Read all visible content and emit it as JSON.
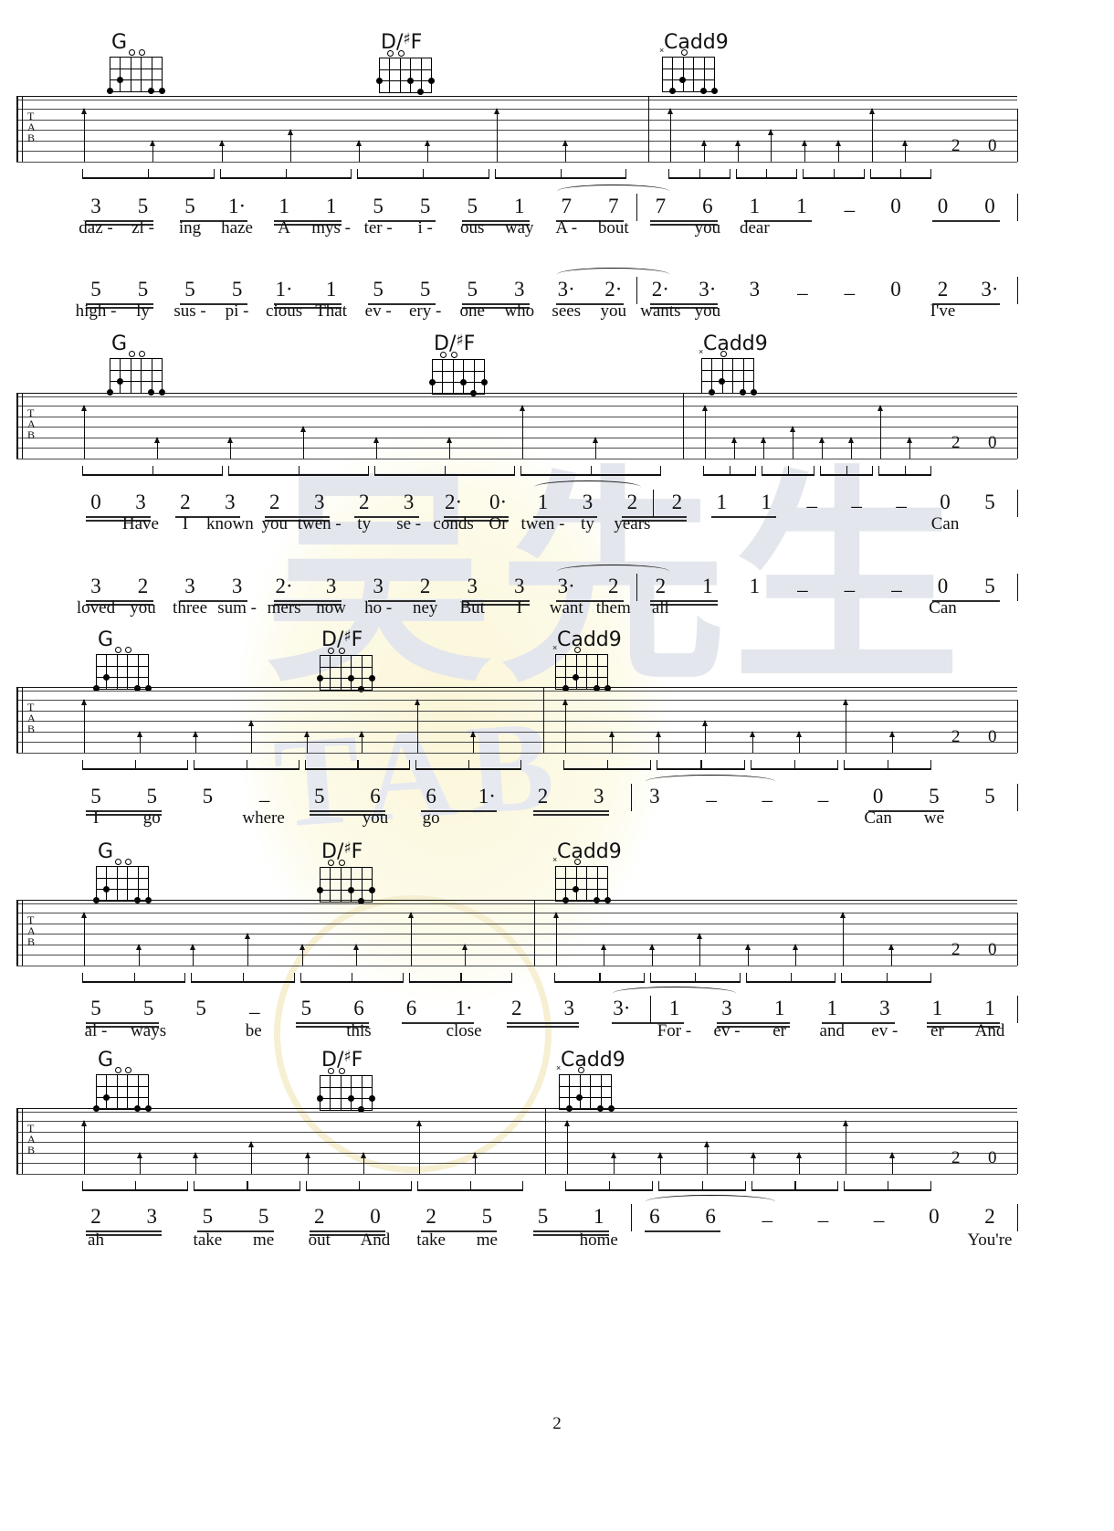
{
  "page": {
    "number": "2"
  },
  "watermarks": {
    "chinese": "吴先生",
    "tab": "TAB"
  },
  "staff_labels": [
    "T",
    "A",
    "B"
  ],
  "chords": [
    {
      "name": "G",
      "accidental": "",
      "mutes": [],
      "opens": [
        2,
        3
      ],
      "dots": [
        [
          1,
          2
        ],
        [
          0,
          3
        ],
        [
          4,
          3
        ],
        [
          5,
          3
        ]
      ]
    },
    {
      "name": "D/",
      "accidental": "#",
      "suffix": "F",
      "mutes": [],
      "opens": [
        1,
        2
      ],
      "dots": [
        [
          0,
          2
        ],
        [
          3,
          2
        ],
        [
          5,
          2
        ],
        [
          4,
          3
        ]
      ]
    },
    {
      "name": "Cadd9",
      "accidental": "",
      "mutes": [
        0
      ],
      "opens": [
        2
      ],
      "dots": [
        [
          2,
          2
        ],
        [
          1,
          3
        ],
        [
          4,
          3
        ],
        [
          5,
          3
        ]
      ]
    }
  ],
  "tab_fret_numbers": [
    "2",
    "0"
  ],
  "systems": [
    {
      "chords": [
        "G",
        "D/#F",
        "Cadd9"
      ],
      "lines": [
        {
          "notes": [
            "3",
            "5",
            "5",
            "1·",
            "1",
            "1",
            "5",
            "5",
            "5",
            "1",
            "7",
            "7",
            "7",
            "6",
            "1",
            "1",
            "–",
            "0",
            "0",
            "0"
          ],
          "lyrics": [
            "daz -",
            "zl -",
            "ing",
            "haze",
            "A",
            "mys -",
            "ter -",
            "i -",
            "ous",
            "way",
            "A -",
            "bout",
            "",
            "you",
            "dear",
            "",
            "",
            "",
            "",
            ""
          ]
        },
        {
          "notes": [
            "5",
            "5",
            "5",
            "5",
            "1·",
            "1",
            "5",
            "5",
            "5",
            "3",
            "3·",
            "2·",
            "2·",
            "3·",
            "3",
            "–",
            "–",
            "0",
            "2",
            "3·"
          ],
          "lyrics": [
            "high -",
            "ly",
            "sus -",
            "pi -",
            "cious",
            "That",
            "ev -",
            "ery -",
            "one",
            "who",
            "sees",
            "you",
            "wants",
            "you",
            "",
            "",
            "",
            "",
            "I've",
            ""
          ]
        }
      ]
    },
    {
      "chords": [
        "G",
        "D/#F",
        "Cadd9"
      ],
      "lines": [
        {
          "notes": [
            "0",
            "3",
            "2",
            "3",
            "2",
            "3",
            "2",
            "3",
            "2·",
            "0·",
            "1",
            "3",
            "2",
            "2",
            "1",
            "1",
            "–",
            "–",
            "–",
            "0",
            "5"
          ],
          "lyrics": [
            "",
            "Have",
            "I",
            "known",
            "you",
            "twen -",
            "ty",
            "se -",
            "conds",
            "Or",
            "twen -",
            "ty",
            "years",
            "",
            "",
            "",
            "",
            "",
            "",
            "Can",
            ""
          ]
        },
        {
          "notes": [
            "3",
            "2",
            "3",
            "3",
            "2·",
            "3",
            "3",
            "2",
            "3",
            "3",
            "3·",
            "2",
            "2",
            "1",
            "1",
            "–",
            "–",
            "–",
            "0",
            "5"
          ],
          "lyrics": [
            "loved",
            "you",
            "three",
            "sum -",
            "mers",
            "now",
            "ho -",
            "ney",
            "But",
            "I",
            "want",
            "them",
            "all",
            "",
            "",
            "",
            "",
            "",
            "Can",
            ""
          ]
        }
      ]
    },
    {
      "chords": [
        "G",
        "D/#F",
        "Cadd9"
      ],
      "lines": [
        {
          "notes": [
            "5",
            "5",
            "5",
            "–",
            "5",
            "6",
            "6",
            "1·",
            "2",
            "3",
            "3",
            "–",
            "–",
            "–",
            "0",
            "5",
            "5"
          ],
          "lyrics": [
            "I",
            "go",
            "",
            "where",
            "",
            "you",
            "go",
            "",
            "",
            "",
            "",
            "",
            "",
            "",
            "Can",
            "we",
            ""
          ]
        }
      ]
    },
    {
      "chords": [
        "G",
        "D/#F",
        "Cadd9"
      ],
      "lines": [
        {
          "notes": [
            "5",
            "5",
            "5",
            "–",
            "5",
            "6",
            "6",
            "1·",
            "2",
            "3",
            "3·",
            "1",
            "3",
            "1",
            "1",
            "3",
            "1",
            "1"
          ],
          "lyrics": [
            "al -",
            "ways",
            "",
            "be",
            "",
            "this",
            "",
            "close",
            "",
            "",
            "",
            "For -",
            "ev -",
            "er",
            "and",
            "ev -",
            "er",
            "And"
          ]
        }
      ]
    },
    {
      "chords": [
        "G",
        "D/#F",
        "Cadd9"
      ],
      "lines": [
        {
          "notes": [
            "2",
            "3",
            "5",
            "5",
            "2",
            "0",
            "2",
            "5",
            "5",
            "1",
            "6",
            "6",
            "–",
            "–",
            "–",
            "0",
            "2"
          ],
          "lyrics": [
            "ah",
            "",
            "take",
            "me",
            "out",
            "And",
            "take",
            "me",
            "",
            "home",
            "",
            "",
            "",
            "",
            "",
            "",
            "You're"
          ]
        }
      ]
    }
  ]
}
